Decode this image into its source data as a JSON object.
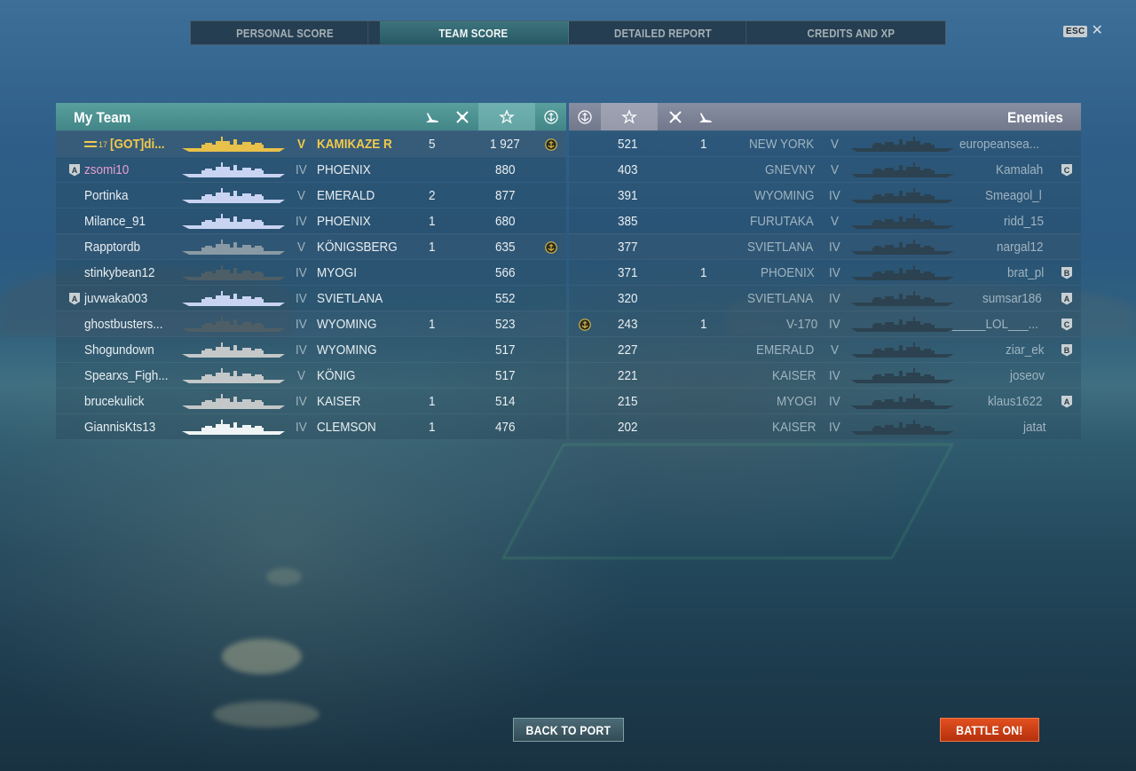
{
  "tabs": [
    {
      "label": "PERSONAL SCORE",
      "active": false
    },
    {
      "label": "TEAM SCORE",
      "active": true
    },
    {
      "label": "DETAILED REPORT",
      "active": false
    },
    {
      "label": "CREDITS AND XP",
      "active": false
    }
  ],
  "esc_label": "ESC",
  "my_team": {
    "title": "My Team",
    "rows": [
      {
        "division": "",
        "rank": "17",
        "name": "[GOT]di...",
        "tier": "V",
        "ship": "KAMIKAZE R",
        "kills": "5",
        "score": "1 927",
        "anchor": true,
        "self": true
      },
      {
        "division": "A",
        "rank": "",
        "name": "zsomi10",
        "tier": "IV",
        "ship": "PHOENIX",
        "kills": "",
        "score": "880",
        "anchor": false,
        "pink": true
      },
      {
        "division": "",
        "rank": "",
        "name": "Portinka",
        "tier": "V",
        "ship": "EMERALD",
        "kills": "2",
        "score": "877",
        "anchor": false
      },
      {
        "division": "",
        "rank": "",
        "name": "Milance_91",
        "tier": "IV",
        "ship": "PHOENIX",
        "kills": "1",
        "score": "680",
        "anchor": false
      },
      {
        "division": "",
        "rank": "",
        "name": "Rapptordb",
        "tier": "V",
        "ship": "KÖNIGSBERG",
        "kills": "1",
        "score": "635",
        "anchor": true
      },
      {
        "division": "",
        "rank": "",
        "name": "stinkybean12",
        "tier": "IV",
        "ship": "MYOGI",
        "kills": "",
        "score": "566",
        "anchor": false
      },
      {
        "division": "A",
        "rank": "",
        "name": "juvwaka003",
        "tier": "IV",
        "ship": "SVIETLANA",
        "kills": "",
        "score": "552",
        "anchor": false
      },
      {
        "division": "",
        "rank": "",
        "name": "ghostbusters...",
        "tier": "IV",
        "ship": "WYOMING",
        "kills": "1",
        "score": "523",
        "anchor": false
      },
      {
        "division": "",
        "rank": "",
        "name": "Shogundown",
        "tier": "IV",
        "ship": "WYOMING",
        "kills": "",
        "score": "517",
        "anchor": false
      },
      {
        "division": "",
        "rank": "",
        "name": "Spearxs_Figh...",
        "tier": "V",
        "ship": "KÖNIG",
        "kills": "",
        "score": "517",
        "anchor": false
      },
      {
        "division": "",
        "rank": "",
        "name": "brucekulick",
        "tier": "IV",
        "ship": "KAISER",
        "kills": "1",
        "score": "514",
        "anchor": false
      },
      {
        "division": "",
        "rank": "",
        "name": "GiannisKts13",
        "tier": "IV",
        "ship": "CLEMSON",
        "kills": "1",
        "score": "476",
        "anchor": false
      }
    ]
  },
  "enemies": {
    "title": "Enemies",
    "rows": [
      {
        "anchor": false,
        "score": "521",
        "kills": "1",
        "ship": "NEW YORK",
        "tier": "V",
        "name": "europeansea...",
        "division": ""
      },
      {
        "anchor": false,
        "score": "403",
        "kills": "",
        "ship": "GNEVNY",
        "tier": "V",
        "name": "Kamalah",
        "division": "C"
      },
      {
        "anchor": false,
        "score": "391",
        "kills": "",
        "ship": "WYOMING",
        "tier": "IV",
        "name": "Smeagol_l",
        "division": ""
      },
      {
        "anchor": false,
        "score": "385",
        "kills": "",
        "ship": "FURUTAKA",
        "tier": "V",
        "name": "ridd_15",
        "division": ""
      },
      {
        "anchor": false,
        "score": "377",
        "kills": "",
        "ship": "SVIETLANA",
        "tier": "IV",
        "name": "nargal12",
        "division": ""
      },
      {
        "anchor": false,
        "score": "371",
        "kills": "1",
        "ship": "PHOENIX",
        "tier": "IV",
        "name": "brat_pl",
        "division": "B"
      },
      {
        "anchor": false,
        "score": "320",
        "kills": "",
        "ship": "SVIETLANA",
        "tier": "IV",
        "name": "sumsar186",
        "division": "A"
      },
      {
        "anchor": true,
        "score": "243",
        "kills": "1",
        "ship": "V-170",
        "tier": "IV",
        "name": "_____LOL___...",
        "division": "C"
      },
      {
        "anchor": false,
        "score": "227",
        "kills": "",
        "ship": "EMERALD",
        "tier": "V",
        "name": "ziar_ek",
        "division": "B"
      },
      {
        "anchor": false,
        "score": "221",
        "kills": "",
        "ship": "KAISER",
        "tier": "IV",
        "name": "joseov",
        "division": ""
      },
      {
        "anchor": false,
        "score": "215",
        "kills": "",
        "ship": "MYOGI",
        "tier": "IV",
        "name": "klaus1622",
        "division": "A"
      },
      {
        "anchor": false,
        "score": "202",
        "kills": "",
        "ship": "KAISER",
        "tier": "IV",
        "name": "jatat",
        "division": ""
      }
    ]
  },
  "buttons": {
    "back": "BACK TO PORT",
    "battle": "BATTLE ON!"
  },
  "colors": {
    "self_gold": "#f2c94c",
    "division_pink": "#e79fd0",
    "battle_button": "#d1431a",
    "my_team_header": "#5faaa0",
    "enemy_header": "#96969f"
  }
}
